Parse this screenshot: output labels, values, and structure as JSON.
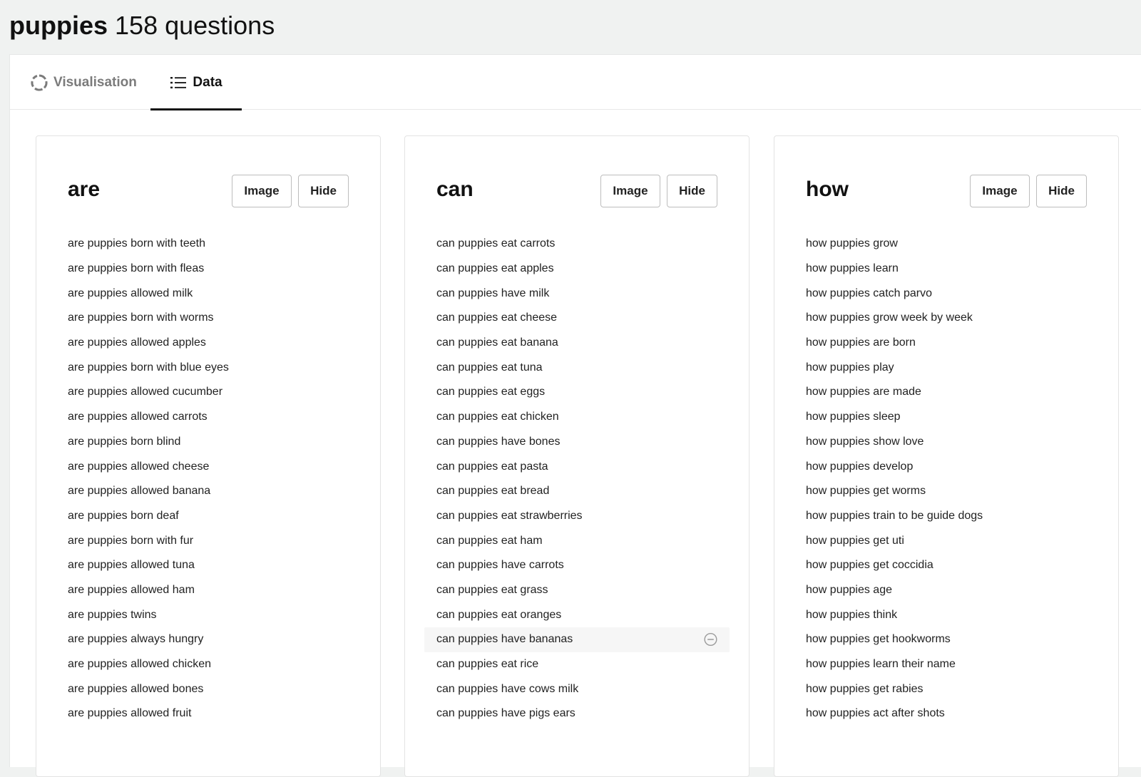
{
  "header": {
    "keyword": "puppies",
    "count_text": "158 questions"
  },
  "tabs": [
    {
      "label": "Visualisation",
      "icon": "loading-circle-icon",
      "active": false
    },
    {
      "label": "Data",
      "icon": "list-icon",
      "active": true
    }
  ],
  "columns": [
    {
      "title": "are",
      "image_label": "Image",
      "hide_label": "Hide",
      "questions": [
        "are puppies born with teeth",
        "are puppies born with fleas",
        "are puppies allowed milk",
        "are puppies born with worms",
        "are puppies allowed apples",
        "are puppies born with blue eyes",
        "are puppies allowed cucumber",
        "are puppies allowed carrots",
        "are puppies born blind",
        "are puppies allowed cheese",
        "are puppies allowed banana",
        "are puppies born deaf",
        "are puppies born with fur",
        "are puppies allowed tuna",
        "are puppies allowed ham",
        "are puppies twins",
        "are puppies always hungry",
        "are puppies allowed chicken",
        "are puppies allowed bones",
        "are puppies allowed fruit"
      ]
    },
    {
      "title": "can",
      "image_label": "Image",
      "hide_label": "Hide",
      "questions": [
        "can puppies eat carrots",
        "can puppies eat apples",
        "can puppies have milk",
        "can puppies eat cheese",
        "can puppies eat banana",
        "can puppies eat tuna",
        "can puppies eat eggs",
        "can puppies eat chicken",
        "can puppies have bones",
        "can puppies eat pasta",
        "can puppies eat bread",
        "can puppies eat strawberries",
        "can puppies eat ham",
        "can puppies have carrots",
        "can puppies eat grass",
        "can puppies eat oranges",
        "can puppies have bananas",
        "can puppies eat rice",
        "can puppies have cows milk",
        "can puppies have pigs ears"
      ]
    },
    {
      "title": "how",
      "image_label": "Image",
      "hide_label": "Hide",
      "questions": [
        "how puppies grow",
        "how puppies learn",
        "how puppies catch parvo",
        "how puppies grow week by week",
        "how puppies are born",
        "how puppies play",
        "how puppies are made",
        "how puppies sleep",
        "how puppies show love",
        "how puppies develop",
        "how puppies get worms",
        "how puppies train to be guide dogs",
        "how puppies get uti",
        "how puppies get coccidia",
        "how puppies age",
        "how puppies think",
        "how puppies get hookworms",
        "how puppies learn their name",
        "how puppies get rabies",
        "how puppies act after shots"
      ]
    }
  ],
  "hovered_item": {
    "column": 1,
    "index": 16,
    "icon": "remove-circle-icon"
  }
}
